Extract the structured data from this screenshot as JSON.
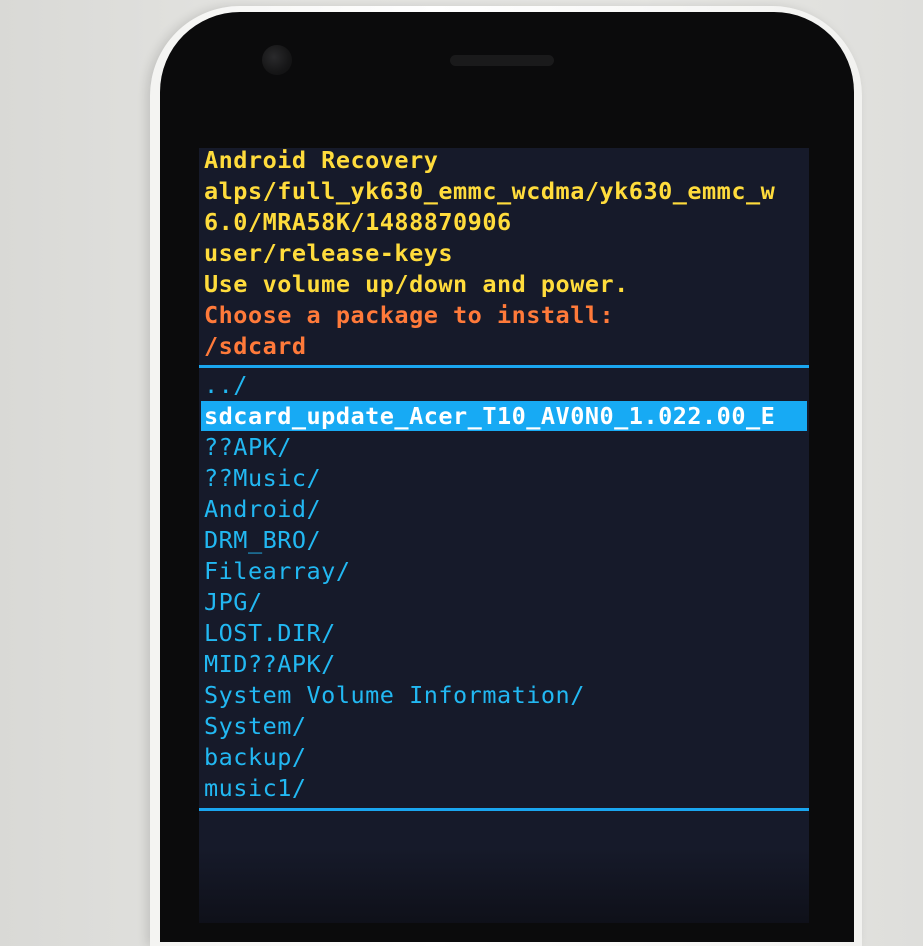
{
  "header": {
    "title": "Android Recovery",
    "build_line_1": "alps/full_yk630_emmc_wcdma/yk630_emmc_w",
    "build_line_2": "6.0/MRA58K/1488870906",
    "build_line_3": "user/release-keys",
    "instructions": "Use volume up/down and power."
  },
  "prompt": {
    "message": "Choose a package to install:",
    "path": "/sdcard"
  },
  "file_list": {
    "items": [
      "../",
      "sdcard_update_Acer_T10_AV0N0_1.022.00_E",
      "??APK/",
      "??Music/",
      "Android/",
      "DRM_BRO/",
      "Filearray/",
      "JPG/",
      "LOST.DIR/",
      "MID??APK/",
      "System Volume Information/",
      "System/",
      "backup/",
      "music1/"
    ],
    "selected_index": 1
  },
  "colors": {
    "header": "#ffdc3c",
    "prompt": "#ff7a3a",
    "list": "#22b8f2",
    "selection": "#17aaf4",
    "screen_bg": "#161a2a"
  }
}
